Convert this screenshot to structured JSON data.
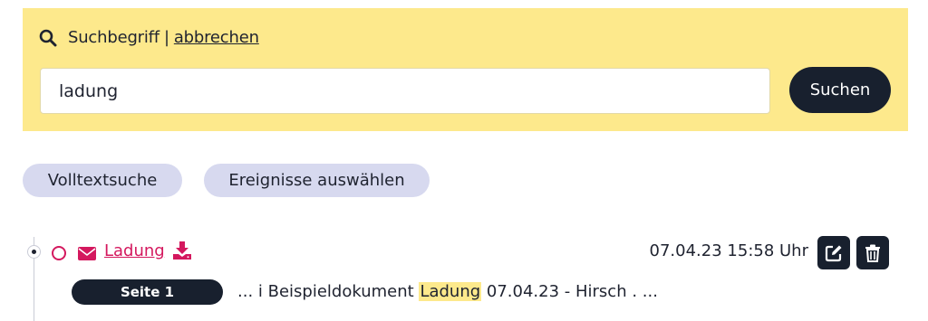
{
  "search": {
    "label": "Suchbegriff",
    "separator": "|",
    "cancel_label": "abbrechen",
    "query_value": "ladung",
    "submit_label": "Suchen",
    "icon": "search-icon"
  },
  "filters": {
    "fulltext_label": "Volltextsuche",
    "events_label": "Ereignisse auswählen"
  },
  "results": [
    {
      "title": "Ladung",
      "timestamp": "07.04.23 15:58 Uhr",
      "page_badge": "Seite 1",
      "snippet_before": "... i Beispieldokument ",
      "snippet_highlight": "Ladung",
      "snippet_after": " 07.04.23 - Hirsch . ...",
      "icons": [
        "mail-icon",
        "download-icon",
        "edit-icon",
        "trash-icon"
      ]
    }
  ],
  "colors": {
    "panel_background": "#fde98c",
    "accent": "#d4185e",
    "dark": "#18202e",
    "pill_background": "#d7d9ef",
    "highlight": "#fde98c"
  }
}
